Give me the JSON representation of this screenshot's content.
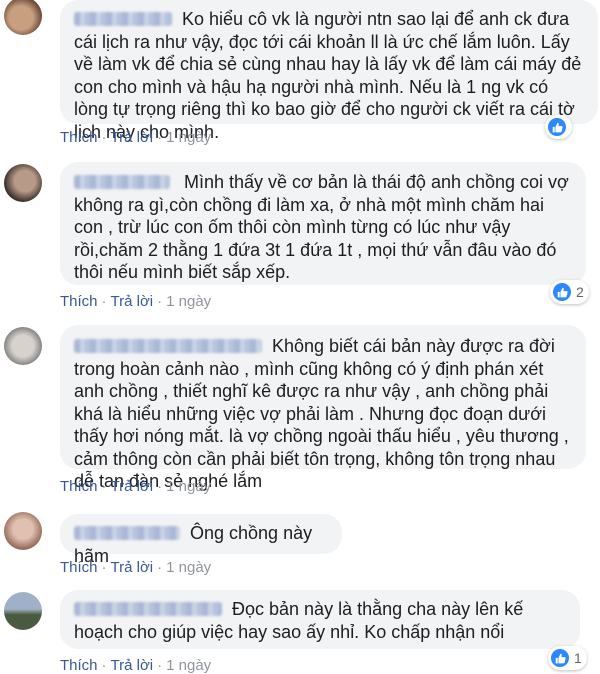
{
  "comments": [
    {
      "author": "Nguyễn Thị Hồng",
      "text": "Ko hiểu cô vk là người ntn sao lại để anh ck đưa cái lịch ra như vậy, đọc tới cái khoản ll là ức chế lắm luôn. Lấy về làm vk để chia sẻ cùng nhau hay là lấy vk để làm cái máy đẻ con cho mình và hậu hạ người nhà mình. Nếu là 1 ng vk có lòng tự trọng riêng thì ko bao giờ để cho người ck viết ra cái tờ lịch này cho mình.",
      "like": "Thích",
      "reply": "Trả lời",
      "time": "1 ngày",
      "reaction_count": "",
      "avatar_colors": [
        "#6b4a3a",
        "#c8a080"
      ]
    },
    {
      "author": "Lê Minh Anh",
      "text": "Mình thấy về cơ bản là thái độ anh chồng coi vợ không ra gì,còn chồng đi làm xa, ở nhà một mình chăm hai con , trừ lúc con ốm thôi còn mình từng có lúc như vậy rồi,chăm 2 thằng 1 đứa 3t 1 đứa 1t , mọi thứ vẫn đâu vào đó thôi nếu mình biết sắp xếp.",
      "like": "Thích",
      "reply": "Trả lời",
      "time": "1 ngày",
      "reaction_count": "2",
      "avatar_colors": [
        "#3a2e2a",
        "#b89a88"
      ]
    },
    {
      "author": "Nguyễn Nguyệt Lan Anh",
      "text": "Không biết cái bản này được ra đời trong hoàn cảnh nào , mình cũng không có ý định phán xét anh chồng , thiết nghĩ kê được ra như vậy , anh chồng phải khá là hiểu những việc vợ phải làm . Nhưng đọc đoạn dưới thấy hơi nóng mắt. là vợ chồng ngoài thấu hiểu , yêu thương , cảm thông còn cần phải biết tôn trọng, không tôn trọng nhau dễ tan đàn sẻ nghé lắm",
      "like": "Thích",
      "reply": "Trả lời",
      "time": "1 ngày",
      "reaction_count": "",
      "avatar_colors": [
        "#7a7a7a",
        "#d8d2cc"
      ]
    },
    {
      "author": "Phạm Văn Thắng",
      "text": "Ông chồng này hãm",
      "like": "Thích",
      "reply": "Trả lời",
      "time": "1 ngày",
      "reaction_count": "",
      "avatar_colors": [
        "#8a6050",
        "#e0c0b0"
      ]
    },
    {
      "author": "Nguyễn Hoàng Ngọc",
      "text": "Đọc bản này là thằng cha này lên kế hoạch cho giúp việc hay sao ấy nhỉ. Ko chấp nhận nổi",
      "like": "Thích",
      "reply": "Trả lời",
      "time": "1 ngày",
      "reaction_count": "1",
      "avatar_colors": [
        "#4a5a40",
        "#9fb0c8"
      ]
    }
  ],
  "like_icon": "thumbs-up-icon",
  "like_color": "#2d88ff"
}
